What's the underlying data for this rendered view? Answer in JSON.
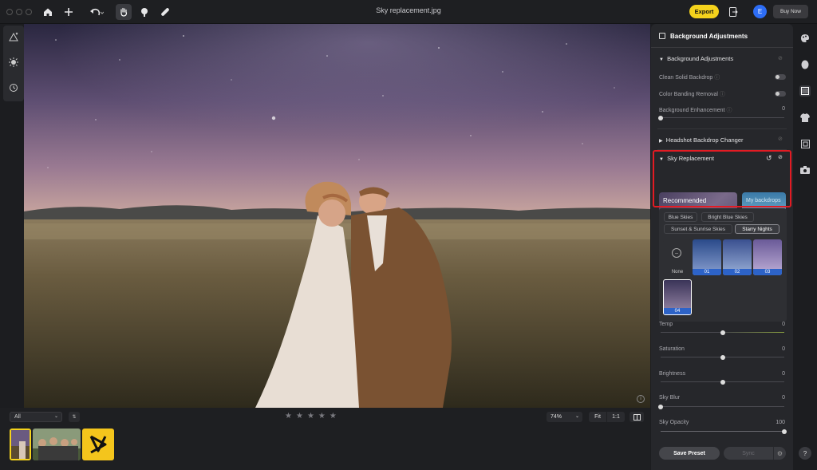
{
  "window": {
    "title": "Sky replacement.jpg"
  },
  "toolbar": {
    "export_label": "Export",
    "avatar_letter": "E",
    "buy_now_label": "Buy Now"
  },
  "bottom": {
    "filter_value": "All",
    "rating_stars": [
      "★",
      "★",
      "★",
      "★",
      "★"
    ],
    "zoom_value": "74%",
    "fit_label": "Fit",
    "one_to_one_label": "1:1"
  },
  "panel": {
    "header_title": "Background Adjustments",
    "bg_section_title": "Background Adjustments",
    "clean_backdrop_label": "Clean Solid Backdrop",
    "color_banding_label": "Color Banding Removal",
    "bg_enhancement_label": "Background Enhancement",
    "bg_enhancement_value": "0",
    "headshot_section_title": "Headshot Backdrop Changer",
    "sky_section_title": "Sky Replacement",
    "recommended_label": "Recommended",
    "my_backdrops_label": "My backdrops",
    "tags": [
      "Blue Skies",
      "Bright Blue Skies",
      "Sunset & Sunrise Skies",
      "Starry Nights"
    ],
    "active_tag": "Starry Nights",
    "sky_none_label": "None",
    "sky_thumb_labels": [
      "01",
      "02",
      "03",
      "04"
    ],
    "sliders": [
      {
        "label": "Temp",
        "value": "0",
        "fraction": 0.5
      },
      {
        "label": "Saturation",
        "value": "0",
        "fraction": 0.5
      },
      {
        "label": "Brightness",
        "value": "0",
        "fraction": 0.5
      },
      {
        "label": "Sky Blur",
        "value": "0",
        "fraction": 0.0
      },
      {
        "label": "Sky Opacity",
        "value": "100",
        "fraction": 1.0
      }
    ],
    "save_preset_label": "Save Preset",
    "sync_label": "Sync"
  },
  "rail": {
    "help_label": "?"
  },
  "colors": {
    "accent": "#f4d21c",
    "highlight": "#e31b23",
    "selection_blue": "#2d63c8"
  }
}
